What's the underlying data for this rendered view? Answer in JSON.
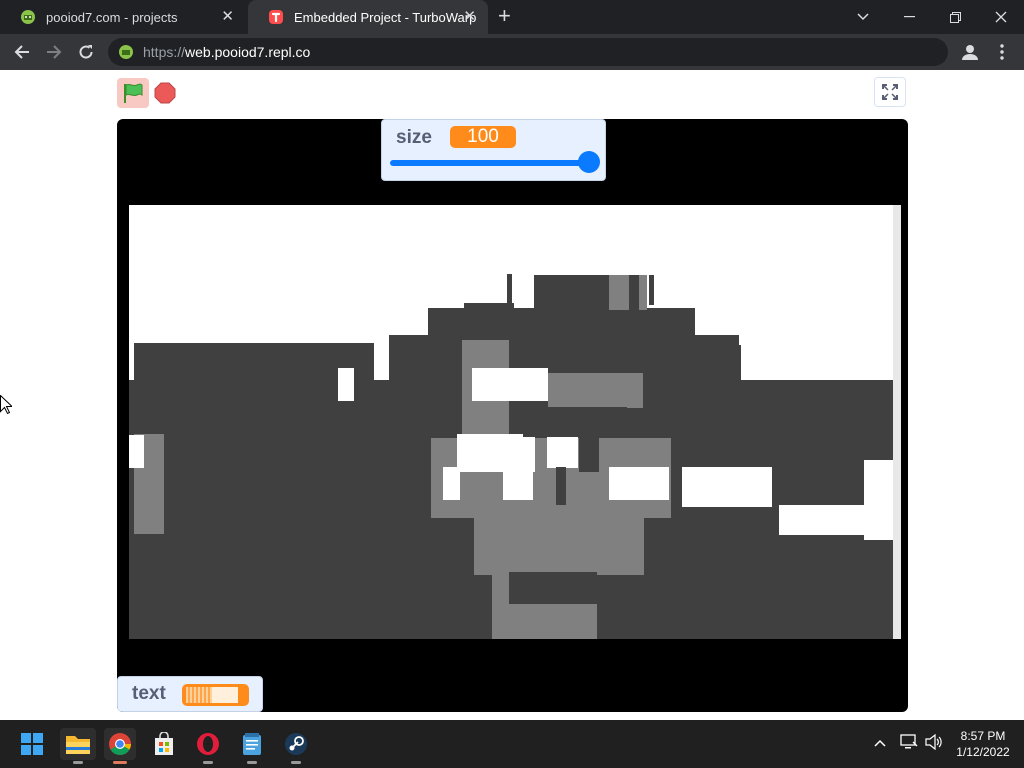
{
  "tabs": [
    {
      "title": "pooiod7.com - projects",
      "favicon": "android-icon"
    },
    {
      "title": "Embedded Project - TurboWarp",
      "favicon": "turbowarp-icon"
    }
  ],
  "address": {
    "scheme": "https://",
    "host": "web.pooiod7.repl.co"
  },
  "monitors": {
    "size": {
      "label": "size",
      "value": "100",
      "slider_fraction": 1.0
    },
    "text": {
      "label": "text"
    }
  },
  "colors": {
    "stage_bg": "#000000",
    "monitor_bg": "#e6f0ff",
    "monitor_value": "#ff8c1a",
    "slider": "#0a7bff",
    "canvas_dark": "#404040",
    "canvas_mid": "#808080"
  },
  "taskbar": {
    "icons": [
      "start-icon",
      "file-explorer-icon",
      "chrome-icon",
      "store-icon",
      "opera-icon",
      "notepad-icon",
      "steam-icon"
    ],
    "time": "8:57 PM",
    "date": "1/12/2022"
  }
}
